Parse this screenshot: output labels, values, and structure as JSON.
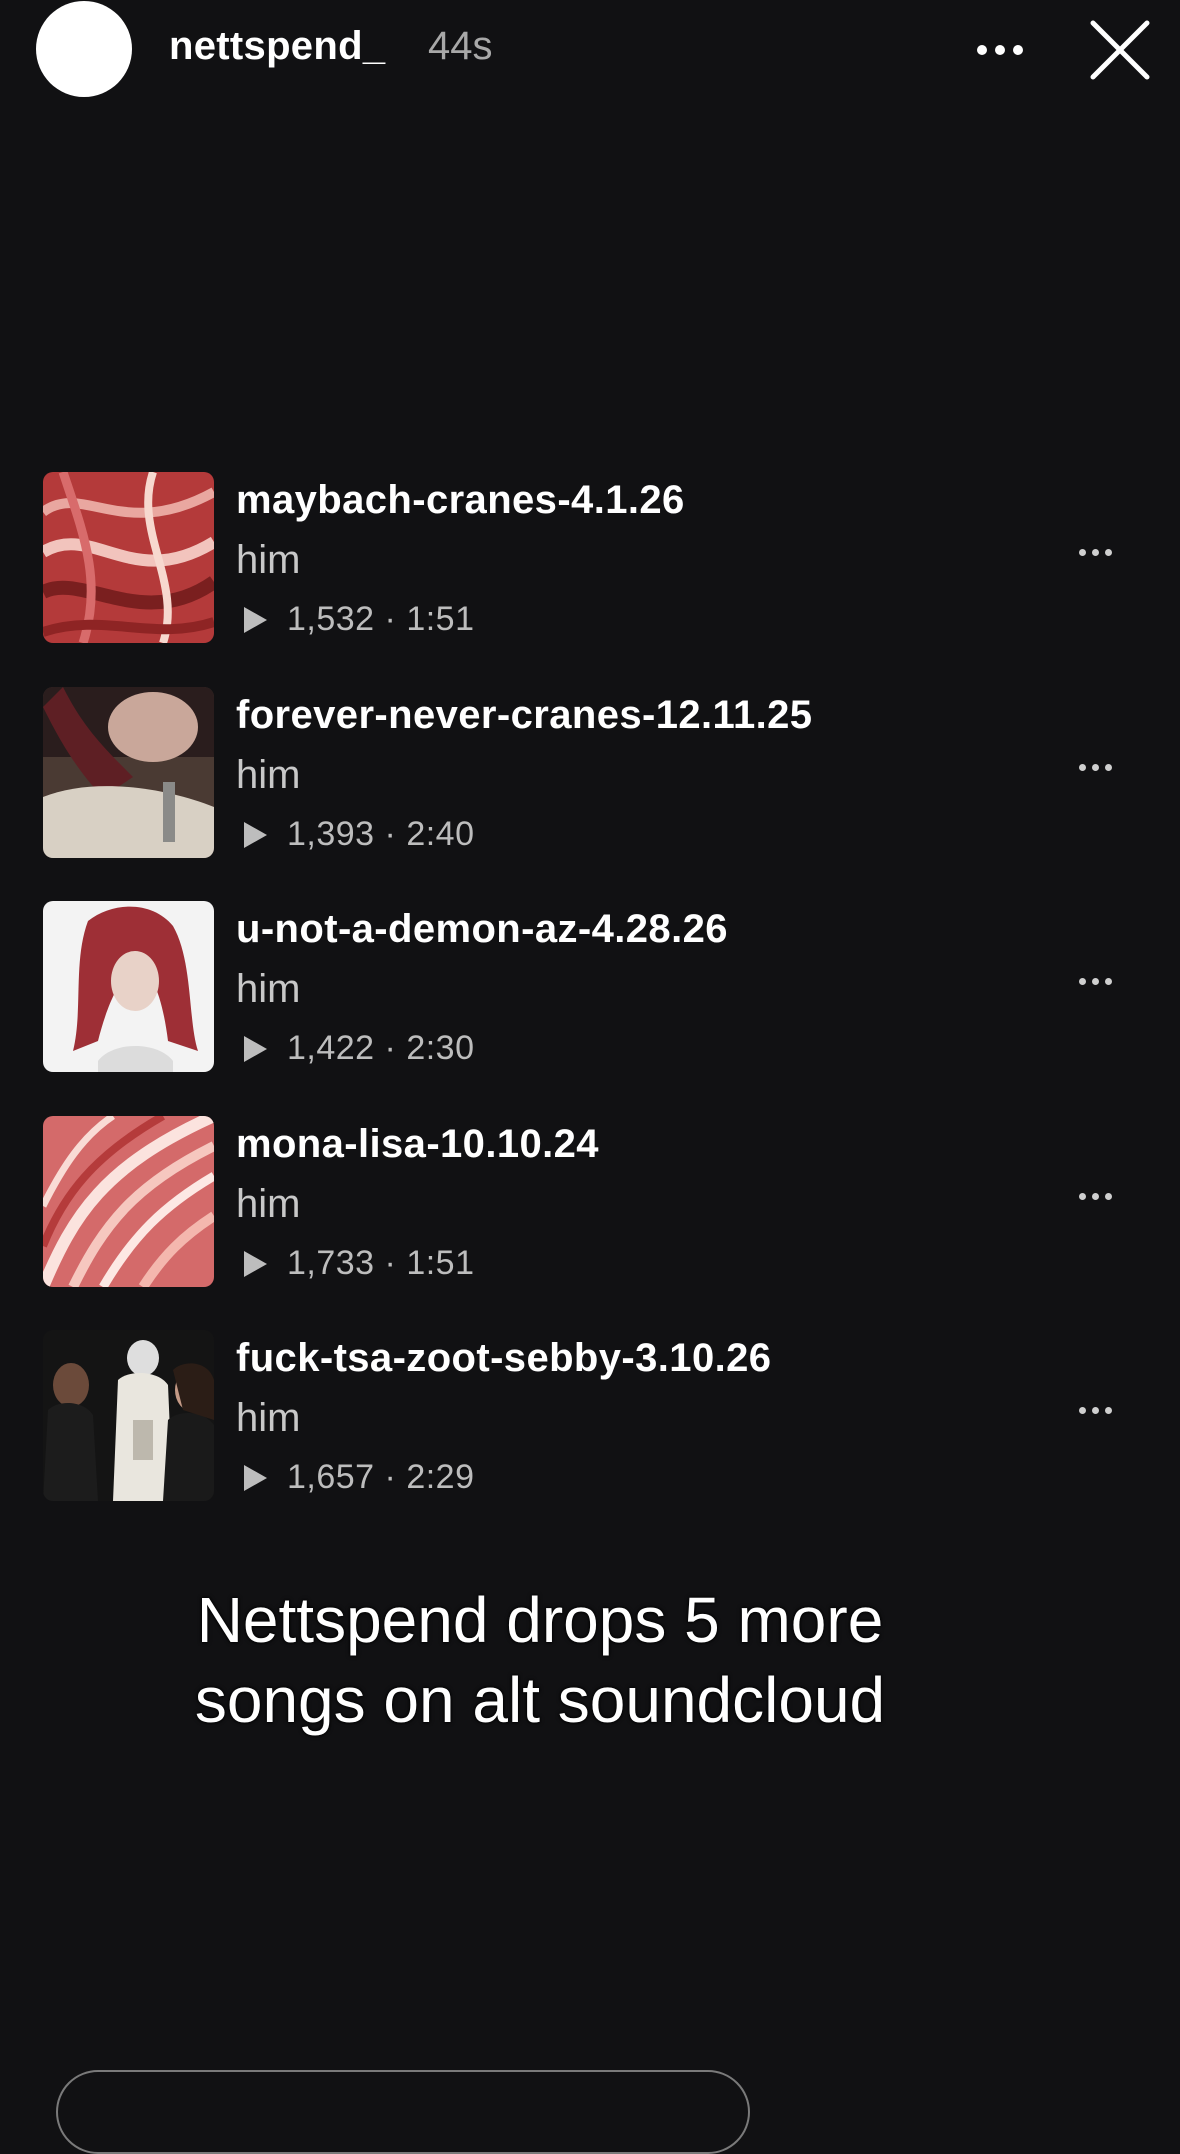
{
  "story": {
    "username": "nettspend_",
    "time_ago": "44s"
  },
  "tracks": [
    {
      "title": "maybach-cranes-4.1.26",
      "artist": "him",
      "plays": "1,532",
      "duration": "1:51",
      "cover": "red-wires"
    },
    {
      "title": "forever-never-cranes-12.11.25",
      "artist": "him",
      "plays": "1,393",
      "duration": "2:40",
      "cover": "red-hair-portrait"
    },
    {
      "title": "u-not-a-demon-az-4.28.26",
      "artist": "him",
      "plays": "1,422",
      "duration": "2:30",
      "cover": "red-hair-white-bg"
    },
    {
      "title": "mona-lisa-10.10.24",
      "artist": "him",
      "plays": "1,733",
      "duration": "1:51",
      "cover": "pink-wires"
    },
    {
      "title": "fuck-tsa-zoot-sebby-3.10.26",
      "artist": "him",
      "plays": "1,657",
      "duration": "2:29",
      "cover": "group-photo"
    }
  ],
  "caption": {
    "line1": "Nettspend drops 5 more",
    "line2": "songs on alt soundcloud"
  },
  "icons": {
    "more": "more-horizontal-icon",
    "close": "close-icon",
    "play": "play-icon"
  }
}
